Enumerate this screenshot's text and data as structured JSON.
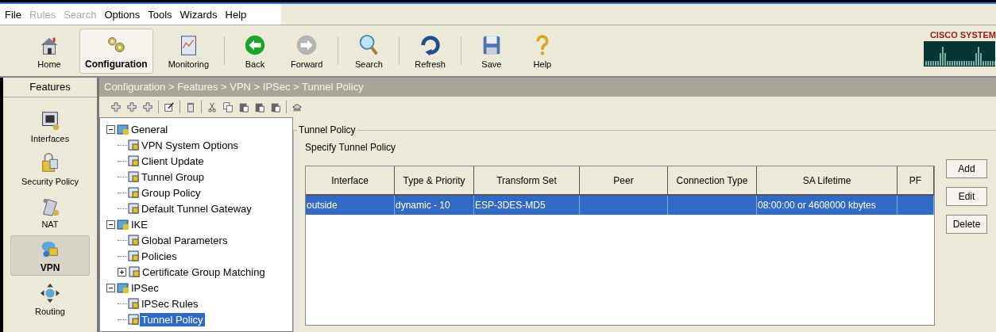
{
  "menu": [
    {
      "label": "File",
      "disabled": false
    },
    {
      "label": "Rules",
      "disabled": true
    },
    {
      "label": "Search",
      "disabled": true
    },
    {
      "label": "Options",
      "disabled": false
    },
    {
      "label": "Tools",
      "disabled": false
    },
    {
      "label": "Wizards",
      "disabled": false
    },
    {
      "label": "Help",
      "disabled": false
    }
  ],
  "toolbar": [
    {
      "label": "Home",
      "selected": false
    },
    {
      "label": "Configuration",
      "selected": true
    },
    {
      "label": "Monitoring",
      "selected": false
    },
    {
      "label": "Back",
      "selected": false
    },
    {
      "label": "Forward",
      "selected": false
    },
    {
      "label": "Search",
      "selected": false
    },
    {
      "label": "Refresh",
      "selected": false
    },
    {
      "label": "Save",
      "selected": false
    },
    {
      "label": "Help",
      "selected": false
    }
  ],
  "logo": "CISCO SYSTEM",
  "features": {
    "title": "Features",
    "items": [
      {
        "label": "Interfaces",
        "selected": false
      },
      {
        "label": "Security Policy",
        "selected": false
      },
      {
        "label": "NAT",
        "selected": false
      },
      {
        "label": "VPN",
        "selected": true
      },
      {
        "label": "Routing",
        "selected": false
      }
    ]
  },
  "breadcrumb": "Configuration > Features > VPN > IPSec > Tunnel Policy",
  "tree": [
    {
      "label": "General",
      "expanded": true,
      "selected": false,
      "children": [
        {
          "label": "VPN System Options",
          "selected": false
        },
        {
          "label": "Client Update",
          "selected": false
        },
        {
          "label": "Tunnel Group",
          "selected": false
        },
        {
          "label": "Group Policy",
          "selected": false
        },
        {
          "label": "Default Tunnel Gateway",
          "selected": false
        }
      ]
    },
    {
      "label": "IKE",
      "expanded": true,
      "selected": false,
      "children": [
        {
          "label": "Global Parameters",
          "selected": false
        },
        {
          "label": "Policies",
          "selected": false
        },
        {
          "label": "Certificate Group Matching",
          "expanded": false,
          "selected": false
        }
      ]
    },
    {
      "label": "IPSec",
      "expanded": true,
      "selected": false,
      "children": [
        {
          "label": "IPSec Rules",
          "selected": false
        },
        {
          "label": "Tunnel Policy",
          "selected": true
        }
      ]
    }
  ],
  "panel": {
    "title": "Tunnel Policy",
    "subtitle": "Specify Tunnel Policy",
    "table": {
      "columns": [
        "Interface",
        "Type & Priority",
        "Transform Set",
        "Peer",
        "Connection Type",
        "SA Lifetime",
        "PF"
      ],
      "rows": [
        {
          "selected": true,
          "cells": [
            "outside",
            "dynamic - 10",
            "ESP-3DES-MD5",
            "",
            "",
            "08:00:00 or 4608000 kbytes",
            ""
          ]
        }
      ]
    },
    "buttons": [
      "Add",
      "Edit",
      "Delete"
    ]
  }
}
